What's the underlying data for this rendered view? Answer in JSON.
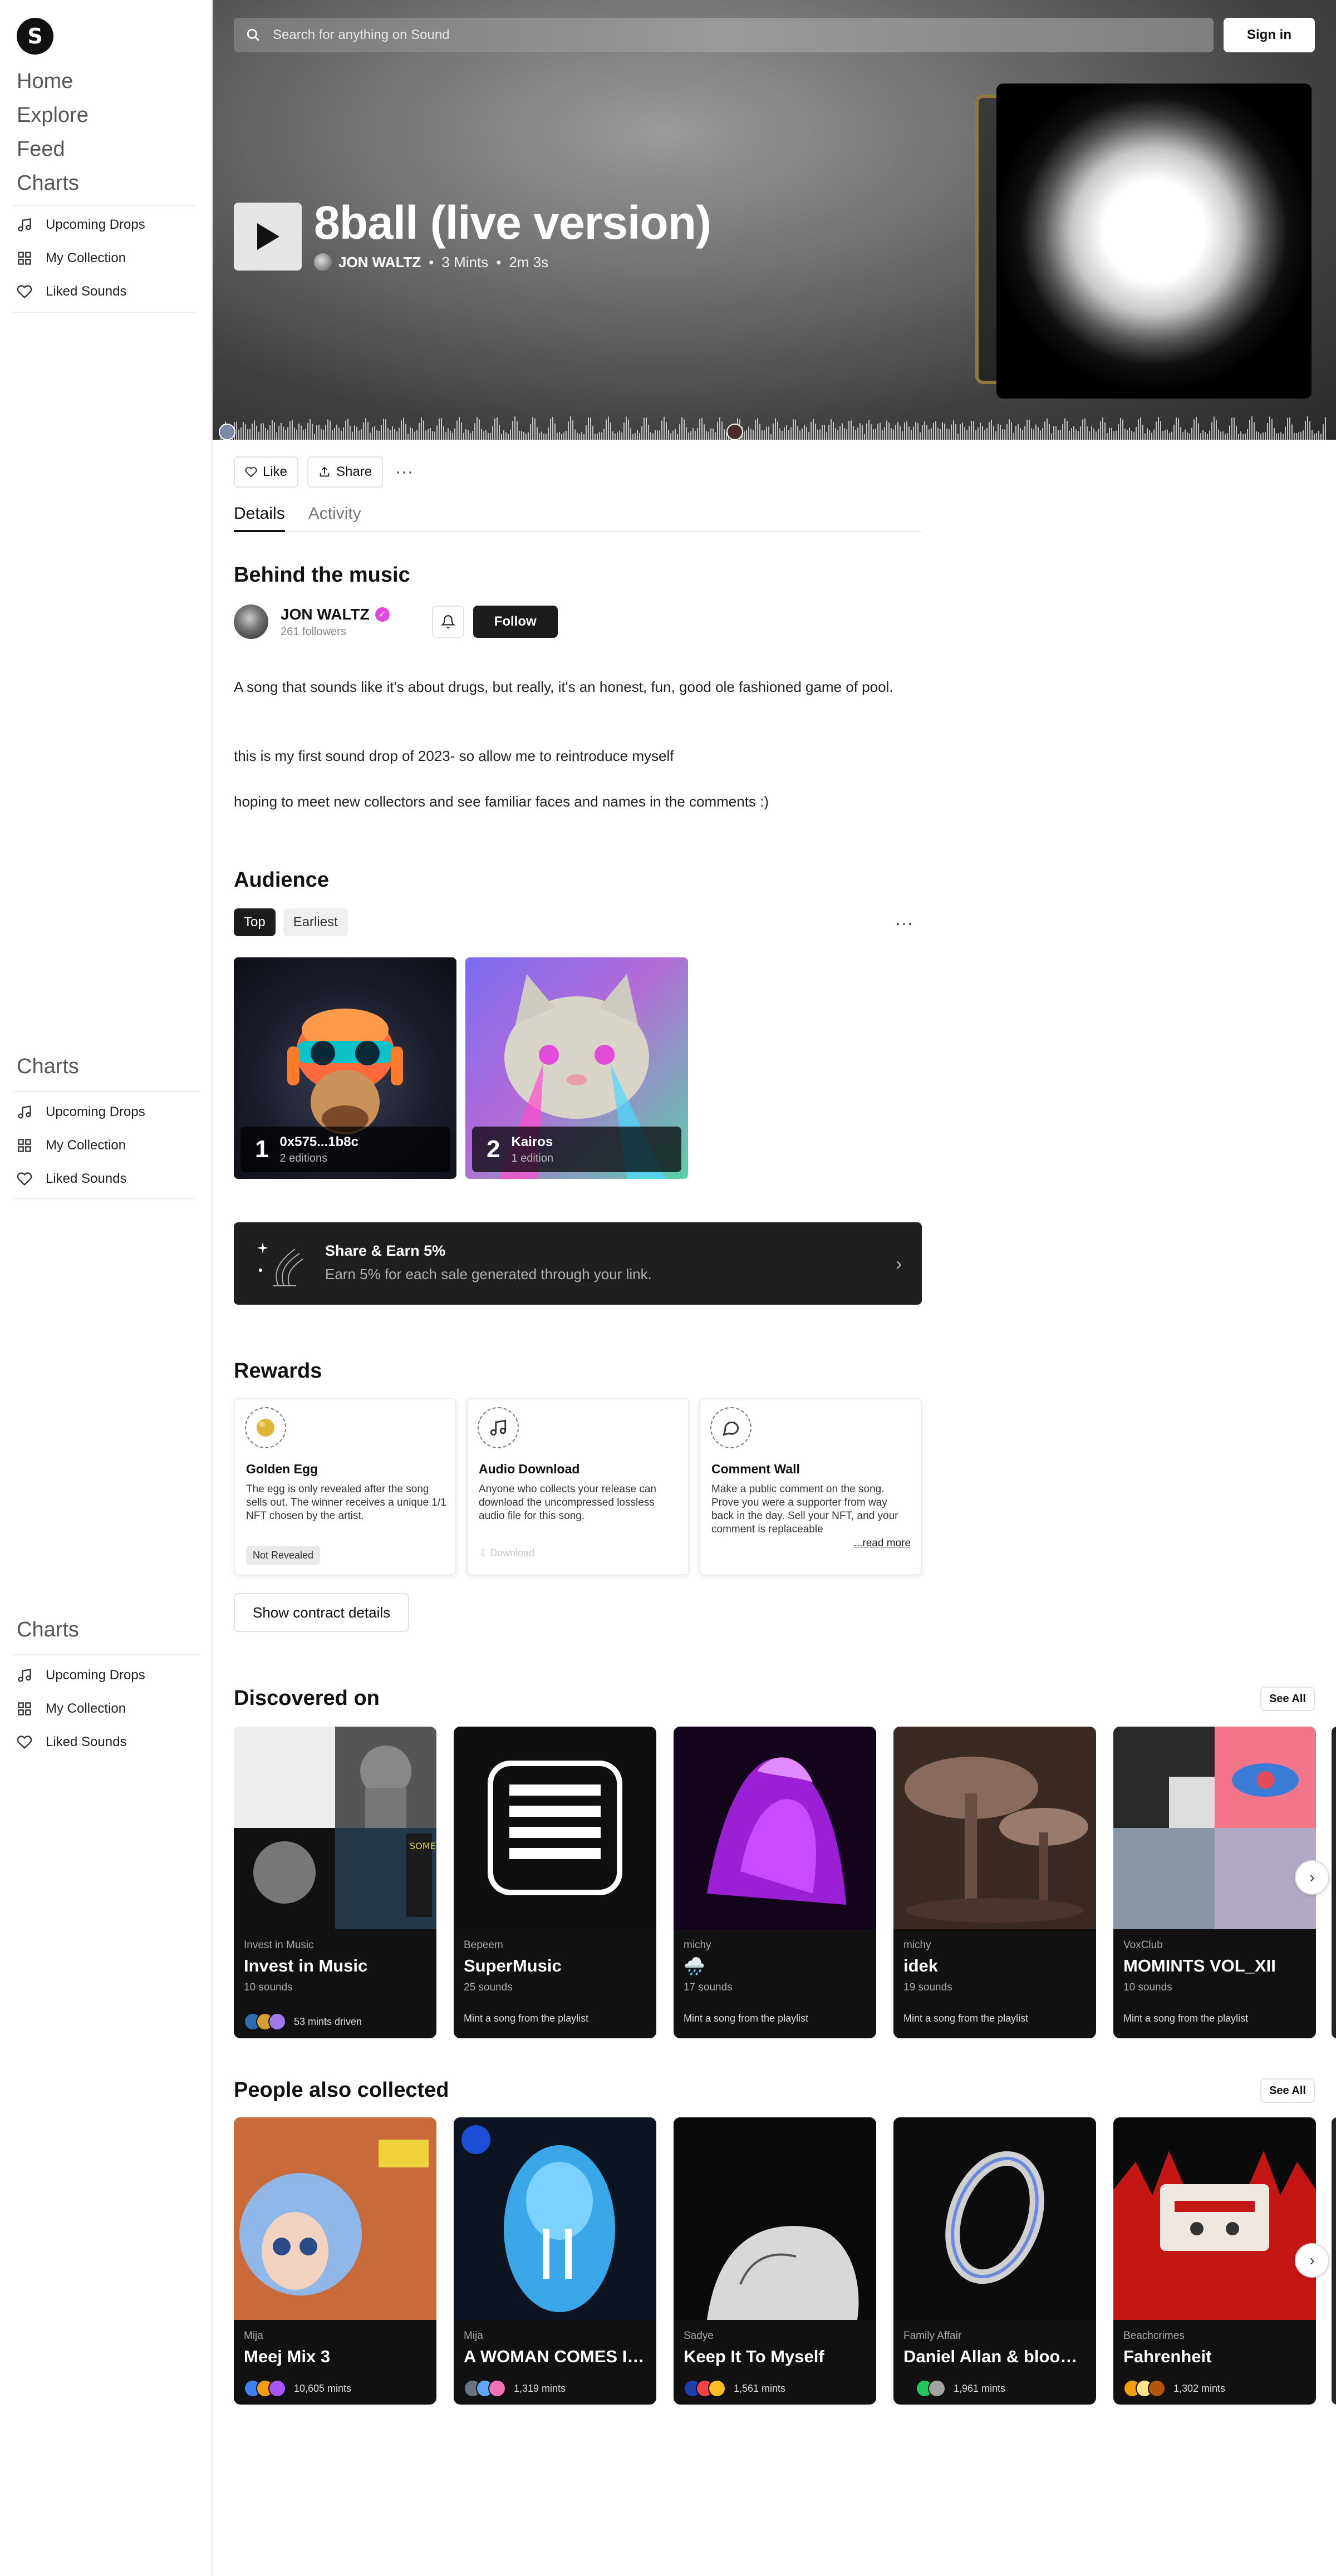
{
  "sidebar": {
    "logo": "S",
    "main_nav": [
      "Home",
      "Explore",
      "Feed",
      "Charts"
    ],
    "section_title": "Charts",
    "items": [
      {
        "label": "Upcoming Drops",
        "icon": "music-note-icon"
      },
      {
        "label": "My Collection",
        "icon": "grid-icon"
      },
      {
        "label": "Liked Sounds",
        "icon": "heart-icon"
      }
    ]
  },
  "header": {
    "search_placeholder": "Search for anything on Sound",
    "signin_label": "Sign in"
  },
  "track": {
    "title": "8ball (live version)",
    "artist": "JON WALTZ",
    "mints": "3 Mints",
    "duration": "2m 3s"
  },
  "actions": {
    "like_label": "Like",
    "share_label": "Share",
    "more_label": "···"
  },
  "tabs": [
    {
      "label": "Details",
      "active": true
    },
    {
      "label": "Activity",
      "active": false
    }
  ],
  "behind": {
    "heading": "Behind the music",
    "artist_name": "JON WALTZ",
    "followers": "261 followers",
    "follow_label": "Follow",
    "paragraphs": [
      "A song that sounds like it's about drugs, but really, it's an honest, fun,  good ole fashioned game of pool.",
      "this is my first sound drop of 2023- so allow me to reintroduce myself",
      "hoping to meet new collectors and see familiar faces and names in the comments :)"
    ]
  },
  "audience": {
    "heading": "Audience",
    "filters": [
      "Top",
      "Earliest"
    ],
    "collectors": [
      {
        "rank": "1",
        "name": "0x575...1b8c",
        "editions": "2 editions"
      },
      {
        "rank": "2",
        "name": "Kairos",
        "editions": "1 edition"
      }
    ]
  },
  "share_earn": {
    "title": "Share & Earn 5%",
    "subtitle": "Earn 5% for each sale generated through your link."
  },
  "rewards": {
    "heading": "Rewards",
    "items": [
      {
        "title": "Golden Egg",
        "desc": "The egg is only revealed after the song sells out. The winner receives a unique 1/1 NFT chosen by the artist.",
        "badge": "Not Revealed"
      },
      {
        "title": "Audio Download",
        "desc": "Anyone who collects your release can download the uncompressed lossless audio file for this song.",
        "action": "Download"
      },
      {
        "title": "Comment Wall",
        "desc": "Make a public comment on the song. Prove you were a supporter from way back in the day. Sell your NFT, and your comment is replaceable",
        "more": "...read more"
      }
    ],
    "contract_label": "Show contract details"
  },
  "discovered": {
    "heading": "Discovered on",
    "see_all": "See All",
    "playlists": [
      {
        "curator": "Invest in Music",
        "title": "Invest in Music",
        "count": "10 sounds",
        "footer": "53 mints driven"
      },
      {
        "curator": "Bepeem",
        "title": "SuperMusic",
        "count": "25 sounds",
        "footer": "Mint a song from the playlist"
      },
      {
        "curator": "michy",
        "title": "🌧️",
        "count": "17 sounds",
        "footer": "Mint a song from the playlist"
      },
      {
        "curator": "michy",
        "title": "idek",
        "count": "19 sounds",
        "footer": "Mint a song from the playlist"
      },
      {
        "curator": "VoxClub",
        "title": "MOMINTS VOL_XII",
        "count": "10 sounds",
        "footer": "Mint a song from the playlist"
      }
    ]
  },
  "also_collected": {
    "heading": "People also collected",
    "see_all": "See All",
    "songs": [
      {
        "artist": "Mija",
        "title": "Meej Mix 3",
        "mints": "10,605 mints"
      },
      {
        "artist": "Mija",
        "title": "A WOMAN COMES INT...",
        "mints": "1,319 mints"
      },
      {
        "artist": "Sadye",
        "title": "Keep It To Myself",
        "mints": "1,561 mints"
      },
      {
        "artist": "Family Affair",
        "title": "Daniel Allan & bloody ...",
        "mints": "1,961 mints"
      },
      {
        "artist": "Beachcrimes",
        "title": "Fahrenheit",
        "mints": "1,302 mints"
      }
    ]
  },
  "colors": {
    "accent": "#1c1c1c",
    "verified": "#e24bd8",
    "hero_bg": "#6f6f6f"
  }
}
